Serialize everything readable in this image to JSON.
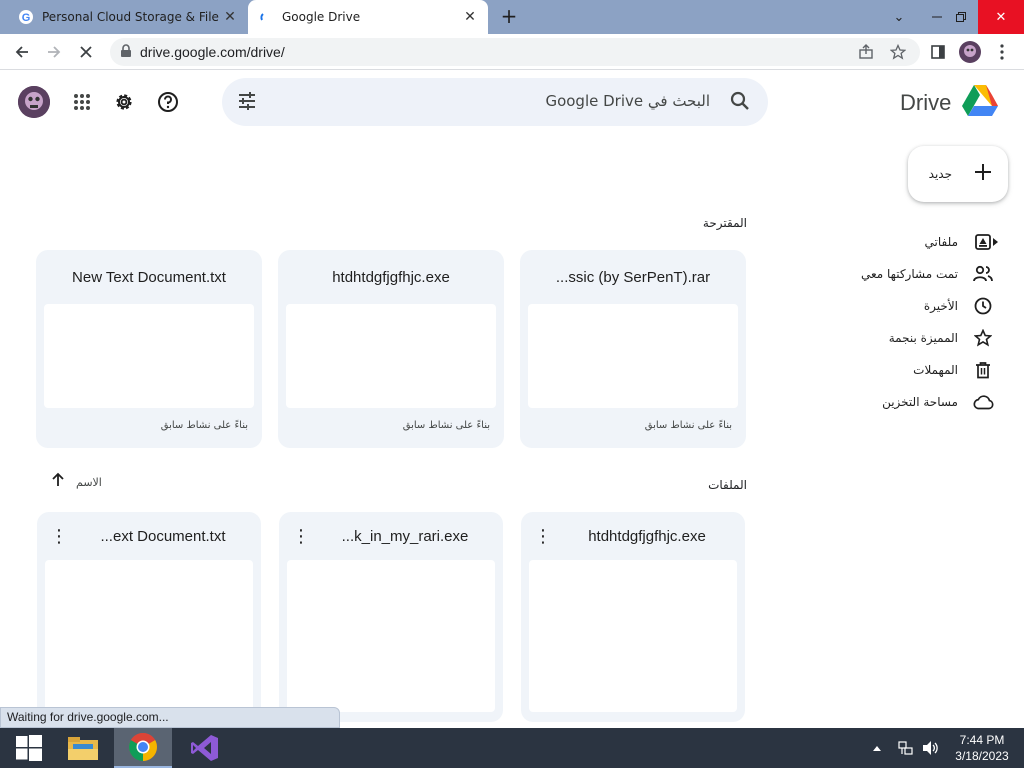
{
  "browser": {
    "tabs": [
      {
        "title": "Personal Cloud Storage & File Sh",
        "active": false
      },
      {
        "title": "Google Drive",
        "active": true
      }
    ],
    "url": "drive.google.com/drive/",
    "status_text": "Waiting for drive.google.com..."
  },
  "drive": {
    "brand": "Drive",
    "search_placeholder": "البحث في Google Drive",
    "new_button": "جديد",
    "nav": [
      {
        "label": "ملفاتي",
        "icon": "my-drive-icon"
      },
      {
        "label": "تمت مشاركتها معي",
        "icon": "shared-icon"
      },
      {
        "label": "الأخيرة",
        "icon": "clock-icon"
      },
      {
        "label": "المميزة بنجمة",
        "icon": "star-icon"
      },
      {
        "label": "المهملات",
        "icon": "trash-icon"
      },
      {
        "label": "مساحة التخزين",
        "icon": "cloud-icon"
      }
    ],
    "suggested_label": "المقترحة",
    "suggested": [
      {
        "name": "...ssic (by SerPenT).rar",
        "reason": "بناءً على نشاط سابق"
      },
      {
        "name": "htdhtdgfjgfhjc.exe",
        "reason": "بناءً على نشاط سابق"
      },
      {
        "name": "New Text Document.txt",
        "reason": "بناءً على نشاط سابق"
      }
    ],
    "files_label": "الملفات",
    "sort_label": "الاسم",
    "files": [
      {
        "name": "htdhtdgfjgfhjc.exe"
      },
      {
        "name": "...k_in_my_rari.exe"
      },
      {
        "name": "...ext Document.txt"
      }
    ]
  },
  "taskbar": {
    "time": "7:44 PM",
    "date": "3/18/2023"
  },
  "colors": {
    "tabstrip": "#8ca2c4",
    "card_bg": "#f0f4f9",
    "search_bg": "#eef2f9",
    "taskbar": "#2b3441"
  }
}
